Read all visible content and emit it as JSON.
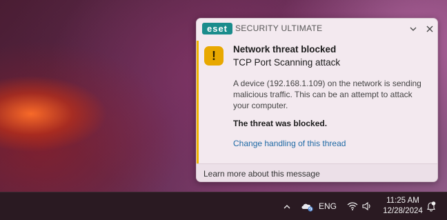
{
  "notification": {
    "brand": "eset",
    "app_name": "SECURITY ULTIMATE",
    "icon": "warning-icon",
    "icon_glyph": "!",
    "accent_color": "#f0b400",
    "title": "Network threat blocked",
    "subtitle": "TCP Port Scanning attack",
    "body": "A device (192.168.1.109) on the network is sending malicious traffic. This can be an attempt to attack your computer.",
    "status": "The threat was blocked.",
    "action_link": "Change handling of this thread",
    "footer_link": "Learn more about this message"
  },
  "taskbar": {
    "icons": [
      "chevron-up-icon",
      "cloud-sync-icon",
      "wifi-icon",
      "speaker-icon",
      "notification-bell-icon"
    ],
    "language": "ENG",
    "time": "11:25 AM",
    "date": "12/28/2024"
  }
}
